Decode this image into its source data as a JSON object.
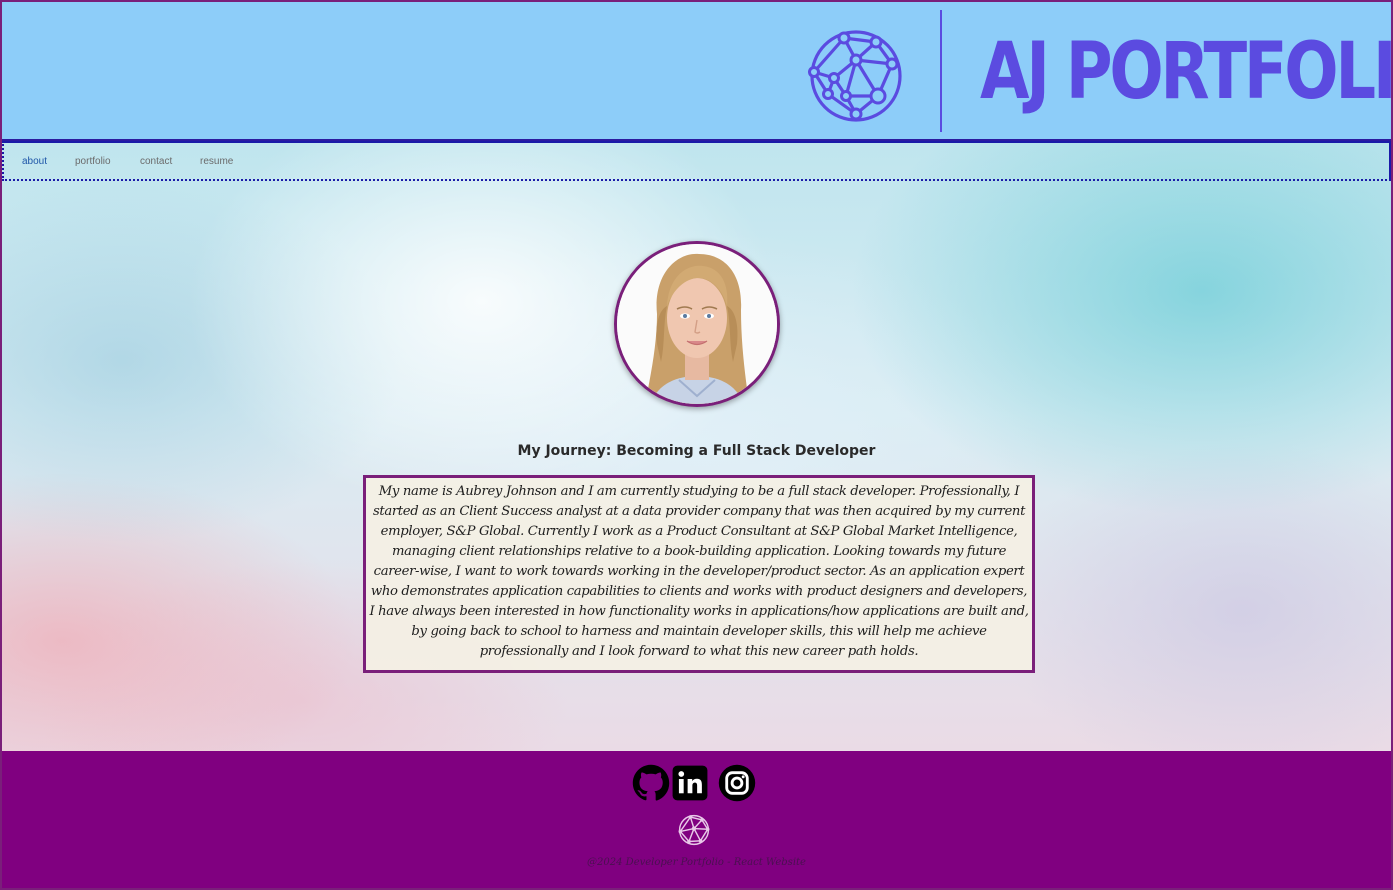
{
  "header": {
    "brand_title": "AJ PORTFOLIO",
    "logo_icon": "network-globe-icon",
    "background_color": "#8dcdf9",
    "brand_color": "#5b4be0"
  },
  "nav": {
    "items": [
      {
        "label": "about",
        "active": true
      },
      {
        "label": "portfolio",
        "active": false
      },
      {
        "label": "contact",
        "active": false
      },
      {
        "label": "resume",
        "active": false
      }
    ]
  },
  "main": {
    "avatar_icon": "profile-photo",
    "title": "My Journey: Becoming a Full Stack Developer",
    "bio": "My name is Aubrey Johnson and I am currently studying to be a full stack developer. Professionally, I started as an Client Success analyst at a data provider company that was then acquired by my current employer, S&P Global. Currently I work as a Product Consultant at S&P Global Market Intelligence, managing client relationships relative to a book-building application. Looking towards my future career-wise, I want to work towards working in the developer/product sector. As an application expert who demonstrates application capabilities to clients and works with product designers and developers, I have always been interested in how functionality works in applications/how applications are built and, by going back to school to harness and maintain developer skills, this will help me achieve professionally and I look forward to what this new career path holds.",
    "accent_color": "#7a1f7a"
  },
  "footer": {
    "social_icons": [
      "github-icon",
      "linkedin-icon",
      "instagram-icon"
    ],
    "logo_icon": "network-globe-icon",
    "copyright": "@2024 Developer Portfolio - React Website",
    "background_color": "#800080"
  }
}
